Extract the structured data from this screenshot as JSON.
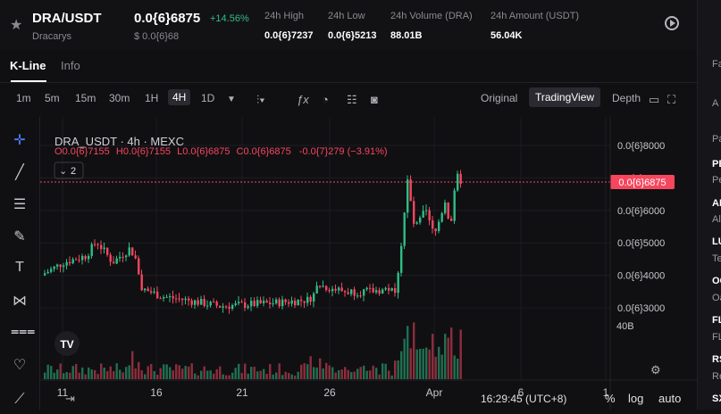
{
  "header": {
    "pair": "DRA/USDT",
    "name": "Dracarys",
    "price": "0.0{6}6875",
    "change": "+14.56%",
    "price_usd": "$ 0.0{6}68",
    "stats": [
      {
        "label": "24h High",
        "value": "0.0{6}7237"
      },
      {
        "label": "24h Low",
        "value": "0.0{6}5213"
      },
      {
        "label": "24h Volume (DRA)",
        "value": "88.01B"
      },
      {
        "label": "24h Amount (USDT)",
        "value": "56.04K"
      }
    ]
  },
  "tabs": [
    "K-Line",
    "Info"
  ],
  "toolbar": {
    "timeframes": [
      "1m",
      "5m",
      "15m",
      "30m",
      "1H",
      "4H",
      "1D"
    ],
    "selected_tf": "4H",
    "views": [
      "Original",
      "TradingView",
      "Depth"
    ],
    "selected_view": "TradingView"
  },
  "legend": {
    "title": "DRA_USDT · 4h · MEXC",
    "o": "0.0{6}7155",
    "h": "0.0{6}7155",
    "l": "0.0{6}6875",
    "c": "0.0{6}6875",
    "change": "-0.0{7}279 (−3.91%)",
    "indicator_count": "2"
  },
  "chart_data": {
    "type": "candlestick",
    "price_axis_labels": [
      "0.0{6}8000",
      "0.0{6}7000",
      "0.0{6}6000",
      "0.0{6}5000",
      "0.0{6}4000",
      "0.0{6}3000"
    ],
    "price_axis_values": [
      8000,
      7000,
      6000,
      5000,
      4000,
      3000
    ],
    "current_price_label": "0.0{6}6875",
    "current_price_value": 6875,
    "volume_axis_label": "40B",
    "x_tick_labels": [
      "11",
      "16",
      "21",
      "26",
      "Apr",
      "6",
      "1"
    ],
    "time": "16:29:45 (UTC+8)",
    "bottom_controls": [
      "%",
      "log",
      "auto"
    ]
  },
  "right_panel": [
    "Fa",
    "A",
    "Pa",
    "PE",
    "Pe",
    "AI",
    "Al",
    "LU",
    "Te",
    "OG",
    "Oa",
    "FL",
    "FL",
    "RS",
    "Re",
    "SX"
  ],
  "colors": {
    "up": "#2ebd85",
    "down": "#f6465d",
    "accent": "#ffffff"
  }
}
